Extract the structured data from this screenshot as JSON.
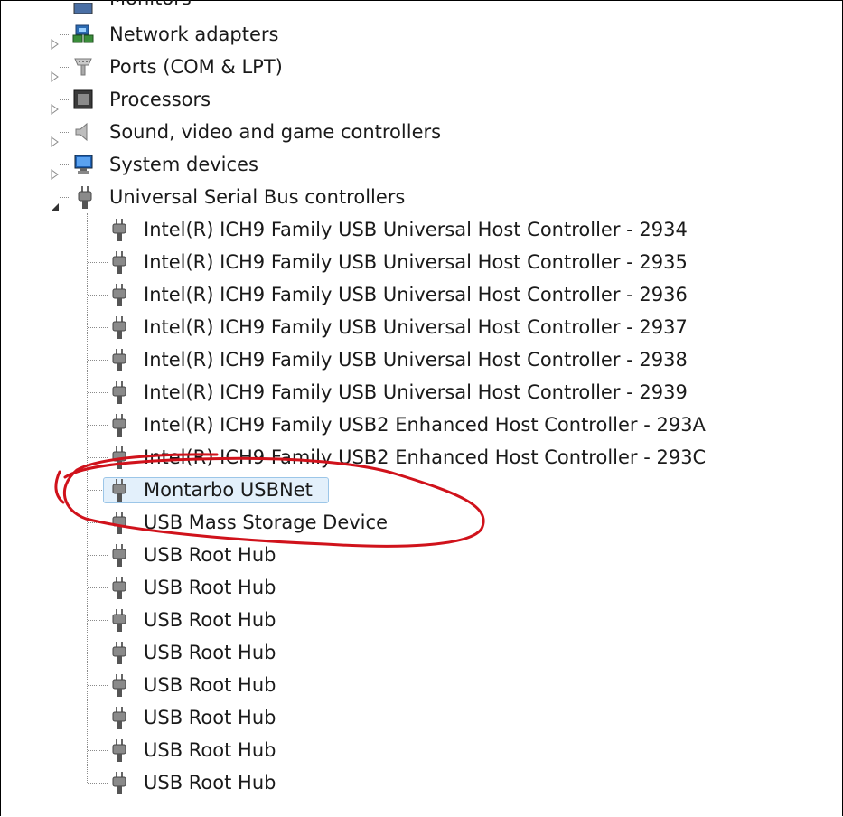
{
  "tree": {
    "partial_top_item": "Monitors",
    "categories": [
      {
        "label": "Network adapters",
        "icon": "network-adapter-icon"
      },
      {
        "label": "Ports (COM & LPT)",
        "icon": "port-icon"
      },
      {
        "label": "Processors",
        "icon": "processor-icon"
      },
      {
        "label": "Sound, video and game controllers",
        "icon": "speaker-icon"
      },
      {
        "label": "System devices",
        "icon": "computer-icon"
      }
    ],
    "usb": {
      "label": "Universal Serial Bus controllers",
      "icon": "usb-plug-icon",
      "children": [
        "Intel(R) ICH9 Family USB Universal Host Controller - 2934",
        "Intel(R) ICH9 Family USB Universal Host Controller - 2935",
        "Intel(R) ICH9 Family USB Universal Host Controller - 2936",
        "Intel(R) ICH9 Family USB Universal Host Controller - 2937",
        "Intel(R) ICH9 Family USB Universal Host Controller - 2938",
        "Intel(R) ICH9 Family USB Universal Host Controller - 2939",
        "Intel(R) ICH9 Family USB2 Enhanced Host Controller - 293A",
        "Intel(R) ICH9 Family USB2 Enhanced Host Controller - 293C",
        "Montarbo USBNet",
        "USB Mass Storage Device",
        "USB Root Hub",
        "USB Root Hub",
        "USB Root Hub",
        "USB Root Hub",
        "USB Root Hub",
        "USB Root Hub",
        "USB Root Hub",
        "USB Root Hub"
      ],
      "selected_child": "Montarbo USBNet"
    }
  },
  "colors": {
    "selection_border": "#9cc6e8",
    "selection_fill": "#e3f0fb",
    "annotation_red": "#d0121b"
  }
}
